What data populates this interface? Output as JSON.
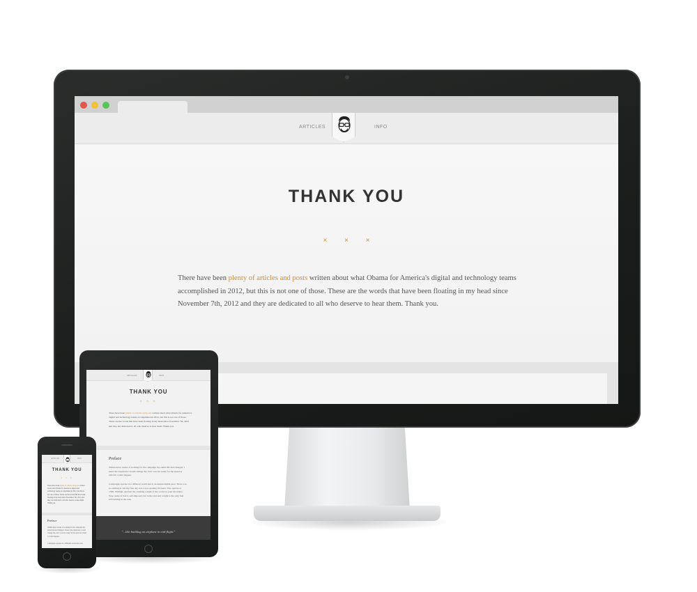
{
  "desktop": {
    "nav": {
      "articles": "ARTICLES",
      "info": "INFO"
    },
    "title": "THANK YOU",
    "divider": "× × ×",
    "intro": {
      "before": "There have been ",
      "link": "plenty of articles and posts",
      "after": " written about what Obama for America's digital and technology teams accomplished in 2012, but this is not one of those. These are the words that have been floating in my head since November 7th, 2012 and they are dedicated to all who deserve to hear them. Thank you."
    }
  },
  "tablet": {
    "nav": {
      "articles": "ARTICLES",
      "info": "INFO"
    },
    "title": "THANK YOU",
    "divider": "× × ×",
    "intro_before": "There have been ",
    "intro_link": "plenty of articles and posts",
    "intro_after": " written about what Obama for America's digital and technology teams accomplished in 2012, but this is not one of those. These are the words that have been floating in my head since November 7th, 2012 and they are dedicated to all who deserve to hear them. Thank you.",
    "section_heading": "Preface",
    "para1": "Within three weeks of working for the campaign my entire life had changed. I knew the experience would change me, but I was not ready for the speed at which it would happen.",
    "para2": "Campaigns operate in a different world and at an unsustainable pace. There was no settling in and my first day was a eye-opening 16 hours. You operate at 1308, 350mph, and feel the crushing weight of the world on your shoulders. Sure, some of that is self-imposed, but in the end said weight is the only fuel left burning in the tank.",
    "quote": "\"...like building an airplane in mid-flight.\""
  },
  "phone": {
    "nav": {
      "articles": "ARTICLES",
      "info": "INFO"
    },
    "title": "THANK YOU",
    "divider": "× × ×",
    "intro_before": "There have been ",
    "intro_link": "plenty of articles and posts",
    "intro_after": " written about what Obama for America's digital and technology teams accomplished in 2012, but this is not one of those. These are the words that have been floating in my head since November 7th, 2012 and they are dedicated to all who deserve to hear them. Thank you.",
    "section_heading": "Preface",
    "para1": "Within three weeks of working for the campaign my entire life had changed. I knew the experience would change me, but I was not ready for the speed at which it would happen.",
    "para2": "Campaigns operate in a different world and at an"
  },
  "colors": {
    "accent": "#d98a2b",
    "bezel": "#1e201f",
    "page_bg": "#f4f4f4",
    "title": "#333333",
    "quote_band": "#3b3b3b"
  },
  "icons": {
    "logo": "avatar-face-icon",
    "window_controls": [
      "close-dot-icon",
      "minimize-dot-icon",
      "zoom-dot-icon"
    ]
  }
}
